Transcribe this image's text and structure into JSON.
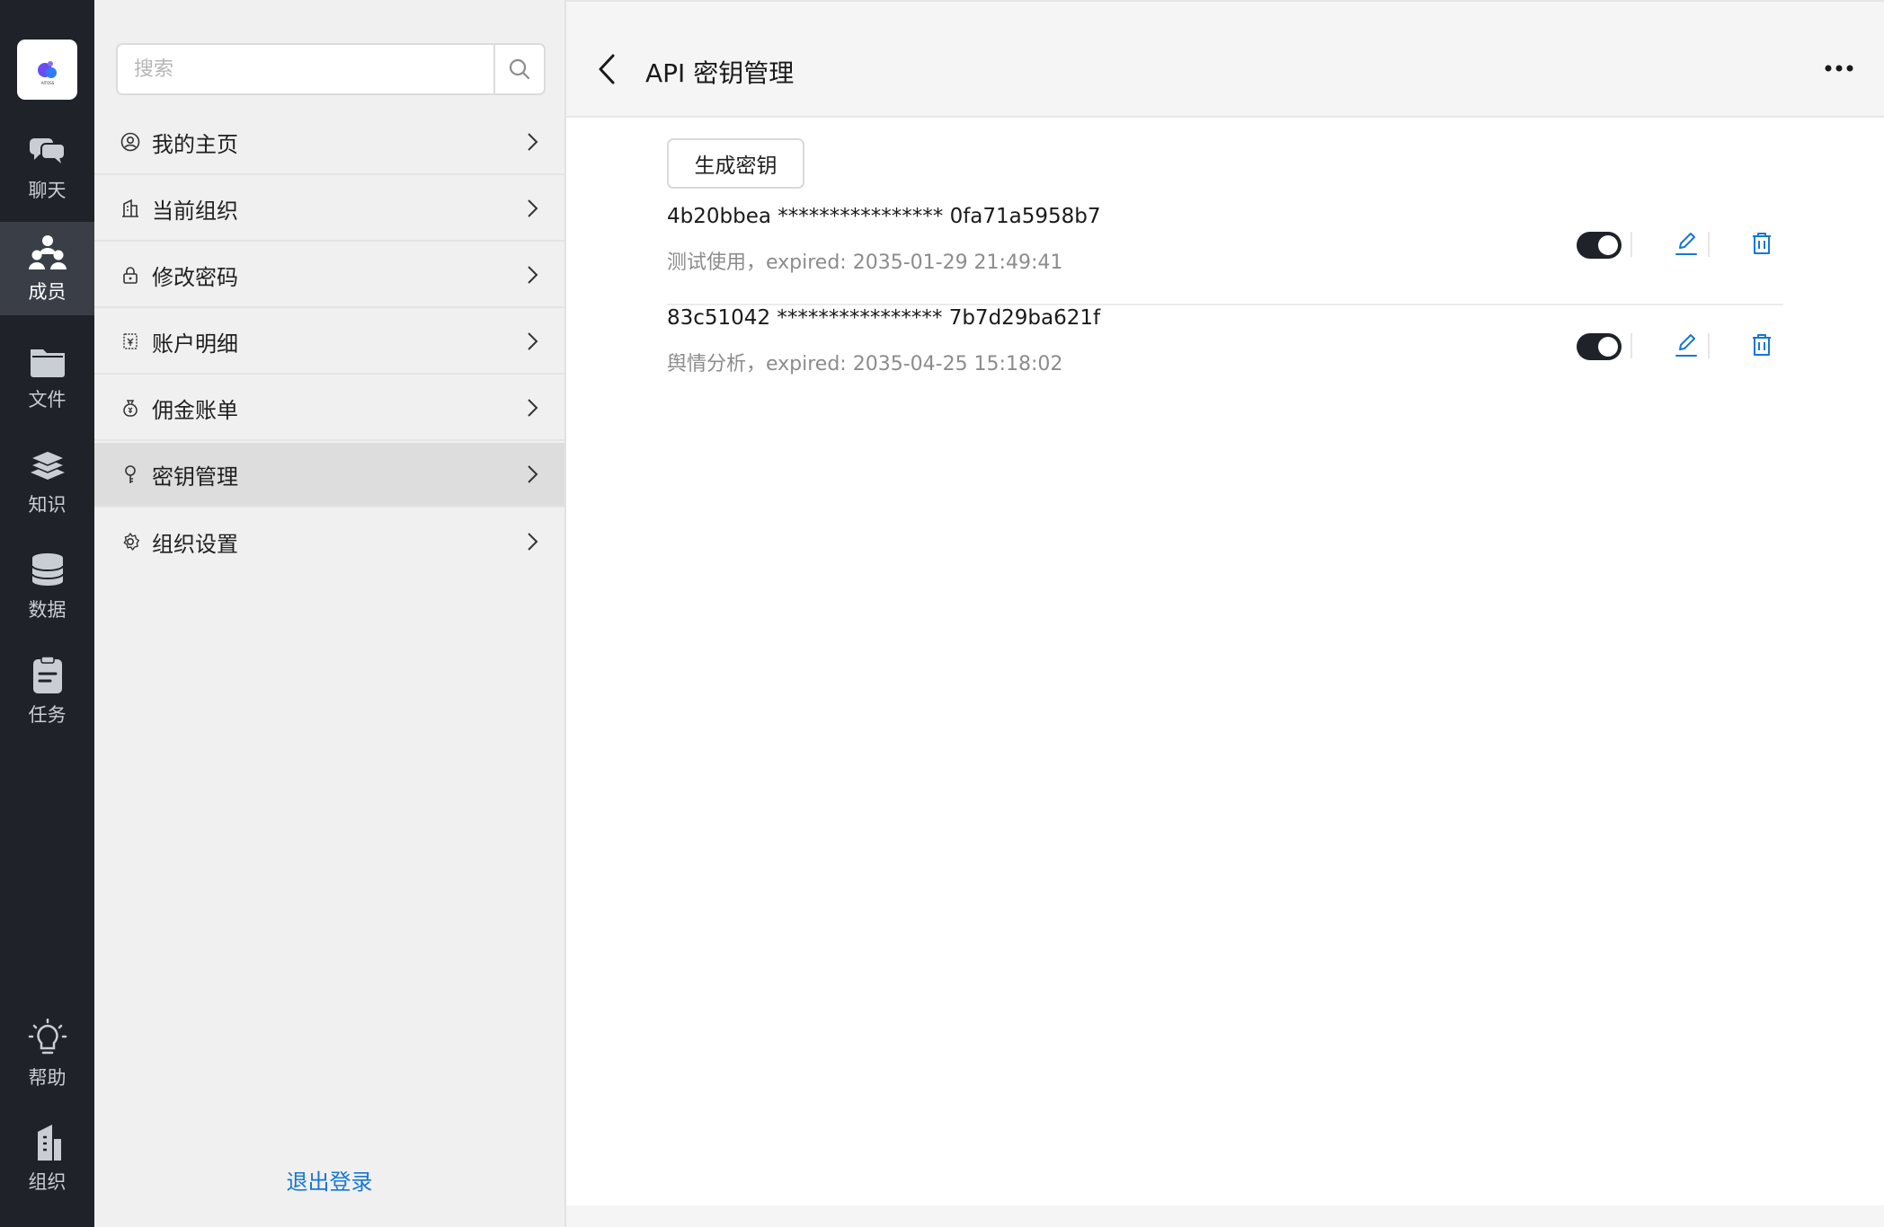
{
  "rail": {
    "logo_text": "AITOSS",
    "items": [
      {
        "label": "聊天",
        "icon": "chat-icon"
      },
      {
        "label": "成员",
        "icon": "members-icon"
      },
      {
        "label": "文件",
        "icon": "folder-icon"
      },
      {
        "label": "知识",
        "icon": "books-icon"
      },
      {
        "label": "数据",
        "icon": "database-icon"
      },
      {
        "label": "任务",
        "icon": "task-icon"
      }
    ],
    "bottom_items": [
      {
        "label": "帮助",
        "icon": "lightbulb-icon"
      },
      {
        "label": "组织",
        "icon": "building-icon"
      }
    ],
    "active": "成员"
  },
  "menu": {
    "search_placeholder": "搜索",
    "items": [
      {
        "label": "我的主页",
        "icon": "user-circle-icon"
      },
      {
        "label": "当前组织",
        "icon": "building-outline-icon"
      },
      {
        "label": "修改密码",
        "icon": "lock-icon"
      },
      {
        "label": "账户明细",
        "icon": "account-detail-icon"
      },
      {
        "label": "佣金账单",
        "icon": "money-bag-icon"
      },
      {
        "label": "密钥管理",
        "icon": "key-icon"
      },
      {
        "label": "组织设置",
        "icon": "gear-icon"
      }
    ],
    "active": "密钥管理",
    "logout_label": "退出登录"
  },
  "header": {
    "title": "API 密钥管理"
  },
  "actions": {
    "generate_label": "生成密钥"
  },
  "keys": [
    {
      "key": "4b20bbea **************** 0fa71a5958b7",
      "description": "测试使用，expired: 2035-01-29 21:49:41",
      "enabled": true
    },
    {
      "key": "83c51042 **************** 7b7d29ba621f",
      "description": "舆情分析，expired: 2035-04-25 15:18:02",
      "enabled": true
    }
  ],
  "colors": {
    "rail_bg": "#1f2329",
    "rail_active": "#3a3f47",
    "link_blue": "#1677d2",
    "menu_bg": "#f0f0f0"
  }
}
